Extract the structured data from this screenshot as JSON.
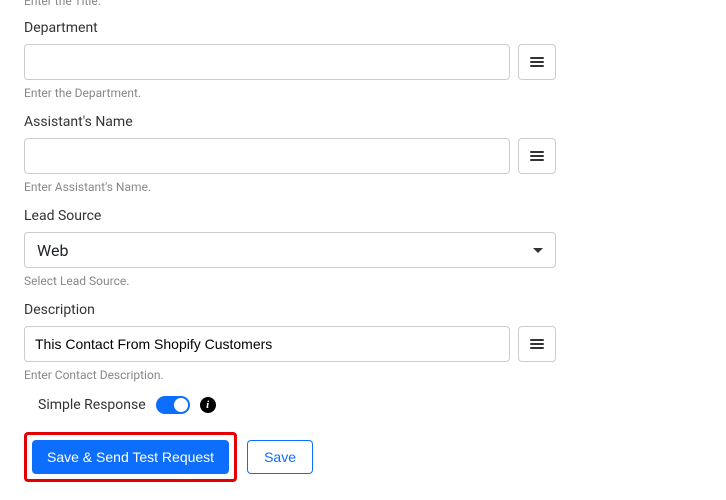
{
  "helpers": {
    "title": "Enter the Title.",
    "department": "Enter the Department.",
    "assistant": "Enter Assistant's Name.",
    "lead_source": "Select Lead Source.",
    "description": "Enter Contact Description."
  },
  "labels": {
    "department": "Department",
    "assistant": "Assistant's Name",
    "lead_source": "Lead Source",
    "description": "Description",
    "simple_response": "Simple Response"
  },
  "values": {
    "department": "",
    "assistant": "",
    "lead_source": "Web",
    "description": "This Contact From Shopify Customers"
  },
  "buttons": {
    "primary": "Save & Send Test Request",
    "secondary": "Save"
  },
  "toggles": {
    "simple_response": true
  }
}
